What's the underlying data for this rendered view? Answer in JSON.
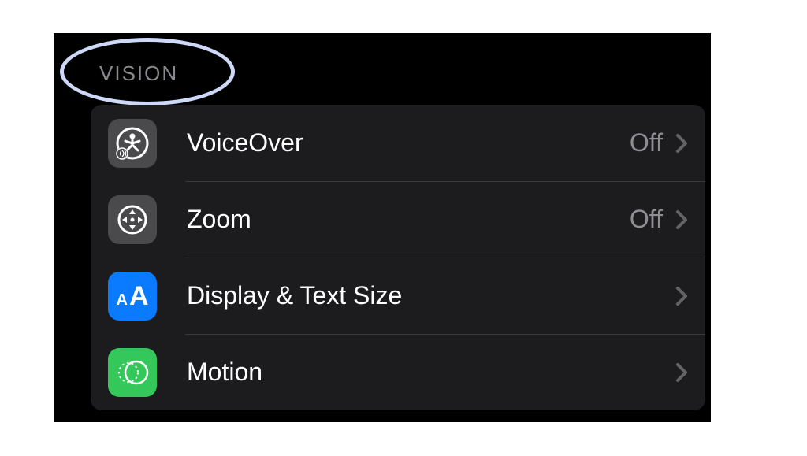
{
  "section": {
    "header": "VISION"
  },
  "rows": [
    {
      "icon": "voiceover-icon",
      "icon_bg": "gray",
      "label": "VoiceOver",
      "value": "Off"
    },
    {
      "icon": "zoom-icon",
      "icon_bg": "gray",
      "label": "Zoom",
      "value": "Off"
    },
    {
      "icon": "text-size-icon",
      "icon_bg": "blue",
      "label": "Display & Text Size",
      "value": ""
    },
    {
      "icon": "motion-icon",
      "icon_bg": "green",
      "label": "Motion",
      "value": ""
    }
  ]
}
